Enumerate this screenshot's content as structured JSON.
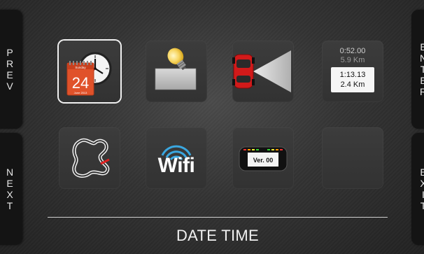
{
  "side_buttons": {
    "prev": [
      "P",
      "R",
      "E",
      "V"
    ],
    "next": [
      "N",
      "E",
      "X",
      "T"
    ],
    "enter": [
      "E",
      "N",
      "T",
      "E",
      "R"
    ],
    "exit": [
      "E",
      "X",
      "I",
      "T"
    ]
  },
  "menu": {
    "selected": "date-time",
    "items": [
      {
        "id": "date-time",
        "icon": "calendar-clock-icon",
        "day": "24",
        "weekday": "Sunday",
        "month_year": "June 2013"
      },
      {
        "id": "light",
        "icon": "lightbulb-icon"
      },
      {
        "id": "lap-detection",
        "icon": "race-car-beam-icon"
      },
      {
        "id": "lap-stats",
        "icon": "lap-stats-icon",
        "prev_time": "0:52.00",
        "prev_dist": "5.9 Km",
        "time": "1:13.13",
        "dist": "2.4 Km"
      },
      {
        "id": "track",
        "icon": "track-map-icon"
      },
      {
        "id": "wifi",
        "icon": "wifi-icon",
        "label": "Wifi"
      },
      {
        "id": "firmware",
        "icon": "dash-display-icon",
        "version": "Ver. 00"
      },
      {
        "id": "empty",
        "icon": ""
      }
    ]
  },
  "footer": {
    "title": "DATE TIME"
  },
  "colors": {
    "calendar": "#e0522a",
    "car": "#d11a1a",
    "wifi": "#3aa7e0"
  }
}
